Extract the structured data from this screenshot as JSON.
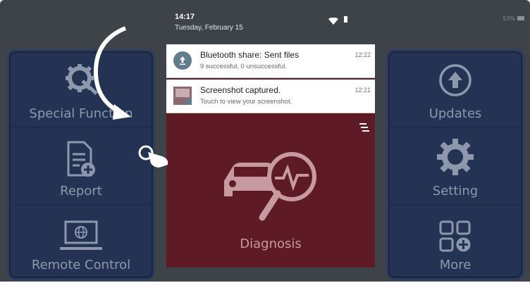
{
  "status_bar": {
    "battery": "53%"
  },
  "left_panel": {
    "items": [
      {
        "label": "Special Function",
        "icon": "wrench-gear-icon"
      },
      {
        "label": "Report",
        "icon": "report-add-icon"
      },
      {
        "label": "Remote Control",
        "icon": "remote-laptop-icon"
      }
    ]
  },
  "right_panel": {
    "items": [
      {
        "label": "Updates",
        "icon": "upload-arrow-icon"
      },
      {
        "label": "Setting",
        "icon": "gear-icon"
      },
      {
        "label": "More",
        "icon": "grid-plus-icon"
      }
    ]
  },
  "notification_shade": {
    "time": "14:17",
    "date": "Tuesday, February 15",
    "notifications": [
      {
        "title": "Bluetooth share: Sent files",
        "subtitle": "9 successful, 0 unsuccessful.",
        "time": "12:22",
        "icon": "upload-circle-icon"
      },
      {
        "title": "Screenshot captured.",
        "subtitle": "Touch to view your screenshot.",
        "time": "12:21",
        "icon": "screenshot-thumbnail-icon"
      }
    ]
  },
  "center_tile": {
    "label": "Diagnosis",
    "icon": "car-diagnosis-icon"
  },
  "colors": {
    "panel": "#243354",
    "diagnosis": "#5e1a25",
    "background": "#3e4249"
  }
}
